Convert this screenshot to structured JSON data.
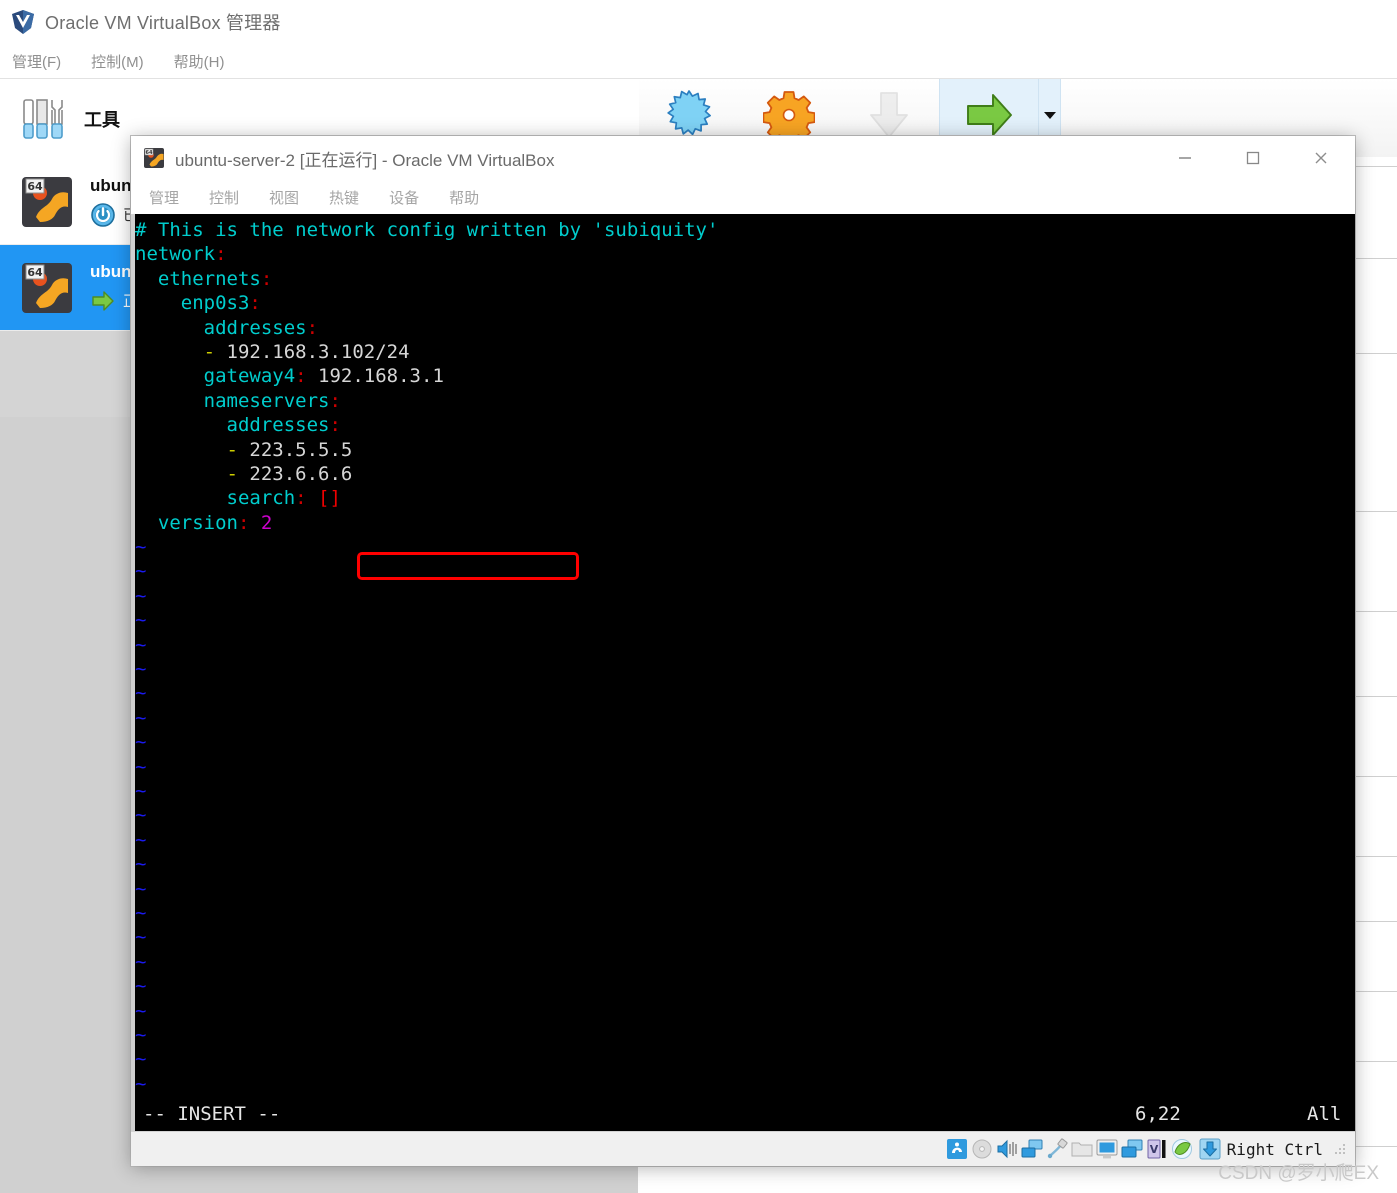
{
  "manager": {
    "title": "Oracle VM VirtualBox 管理器",
    "logo_icon": "virtualbox-logo-icon",
    "menus": [
      {
        "label": "管理(F)",
        "name": "menu-file"
      },
      {
        "label": "控制(M)",
        "name": "menu-machine"
      },
      {
        "label": "帮助(H)",
        "name": "menu-help"
      }
    ],
    "tools": {
      "label": "工具",
      "icon": "tools-icon"
    },
    "vm_list": [
      {
        "name": "ubuntu",
        "state": "已",
        "state_icon": "power-off-icon",
        "os_icon": "ubuntu-64-icon",
        "selected": false
      },
      {
        "name": "ubuntu",
        "state": "正",
        "state_icon": "running-arrow-icon",
        "os_icon": "ubuntu-64-icon",
        "selected": true
      }
    ],
    "toolbar": [
      {
        "name": "new-button",
        "icon": "star-new-icon",
        "state": "enabled"
      },
      {
        "name": "settings-button",
        "icon": "gear-settings-icon",
        "state": "enabled"
      },
      {
        "name": "discard-button",
        "icon": "down-arrow-discard-icon",
        "state": "disabled"
      },
      {
        "name": "start-button",
        "icon": "green-arrow-start-icon",
        "state": "active"
      }
    ],
    "toolbar_caret": {
      "name": "start-dropdown-caret",
      "icon": "chevron-down-icon"
    }
  },
  "vm_window": {
    "title": "ubuntu-server-2 [正在运行] - Oracle VM VirtualBox",
    "title_icon": "ubuntu-vm-icon",
    "window_controls": [
      {
        "name": "minimize-button",
        "icon": "minimize-icon"
      },
      {
        "name": "maximize-button",
        "icon": "maximize-icon"
      },
      {
        "name": "close-button",
        "icon": "close-icon"
      }
    ],
    "menus": [
      {
        "label": "管理",
        "name": "vm-menu-file"
      },
      {
        "label": "控制",
        "name": "vm-menu-machine"
      },
      {
        "label": "视图",
        "name": "vm-menu-view"
      },
      {
        "label": "热键",
        "name": "vm-menu-input"
      },
      {
        "label": "设备",
        "name": "vm-menu-devices"
      },
      {
        "label": "帮助",
        "name": "vm-menu-help"
      }
    ],
    "status_icons": [
      {
        "name": "hard-disk-icon"
      },
      {
        "name": "optical-drive-icon"
      },
      {
        "name": "audio-icon"
      },
      {
        "name": "network-icon"
      },
      {
        "name": "usb-icon"
      },
      {
        "name": "shared-folders-icon"
      },
      {
        "name": "display-icon"
      },
      {
        "name": "video-capture-icon"
      },
      {
        "name": "keyboard-icon"
      },
      {
        "name": "mouse-integration-icon"
      }
    ],
    "host_key": {
      "label": "Right Ctrl",
      "icon": "host-key-icon"
    },
    "resize_grip": {
      "name": "resize-grip-icon"
    }
  },
  "terminal": {
    "lines": [
      [
        {
          "t": "# This is the network config written by 'subiquity'",
          "c": "c-key"
        }
      ],
      [
        {
          "t": "network",
          "c": "c-key"
        },
        {
          "t": ":",
          "c": "c-punct"
        }
      ],
      [
        {
          "t": "  ethernets",
          "c": "c-key"
        },
        {
          "t": ":",
          "c": "c-punct"
        }
      ],
      [
        {
          "t": "    enp0s3",
          "c": "c-key"
        },
        {
          "t": ":",
          "c": "c-punct"
        }
      ],
      [
        {
          "t": "      addresses",
          "c": "c-key"
        },
        {
          "t": ":",
          "c": "c-punct"
        }
      ],
      [
        {
          "t": "      -",
          "c": "c-dash"
        },
        {
          "t": " 192.168.3.102/24",
          "c": "c-val"
        }
      ],
      [
        {
          "t": "      gateway4",
          "c": "c-key"
        },
        {
          "t": ":",
          "c": "c-punct"
        },
        {
          "t": " 192.168.3.1",
          "c": "c-val"
        }
      ],
      [
        {
          "t": "      nameservers",
          "c": "c-key"
        },
        {
          "t": ":",
          "c": "c-punct"
        }
      ],
      [
        {
          "t": "        addresses",
          "c": "c-key"
        },
        {
          "t": ":",
          "c": "c-punct"
        }
      ],
      [
        {
          "t": "        -",
          "c": "c-dash"
        },
        {
          "t": " 223.5.5.5",
          "c": "c-val"
        }
      ],
      [
        {
          "t": "        -",
          "c": "c-dash"
        },
        {
          "t": " 223.6.6.6",
          "c": "c-val"
        }
      ],
      [
        {
          "t": "        search",
          "c": "c-key"
        },
        {
          "t": ":",
          "c": "c-punct"
        },
        {
          "t": " []",
          "c": "c-brk"
        }
      ],
      [
        {
          "t": "  version",
          "c": "c-key"
        },
        {
          "t": ":",
          "c": "c-punct"
        },
        {
          "t": " 2",
          "c": "c-num"
        }
      ]
    ],
    "tilde_count": 23,
    "tilde_glyph": "~",
    "highlight": {
      "name": "ip-address-highlight-box",
      "color": "#ff0000",
      "target": "192.168.3.102/24"
    },
    "status": {
      "mode": "-- INSERT --",
      "position": "6,22",
      "scroll": "All"
    }
  },
  "watermark": "CSDN @罗小爬EX",
  "colors": {
    "selection_blue": "#2196f3",
    "terminal_bg": "#000000",
    "key_cyan": "#00cdcd",
    "punct_red": "#cd0000",
    "dash_yellow": "#cdcd00",
    "num_magenta": "#cd00cd",
    "tilde_blue": "#1a1aee",
    "highlight_red": "#ff0000"
  }
}
